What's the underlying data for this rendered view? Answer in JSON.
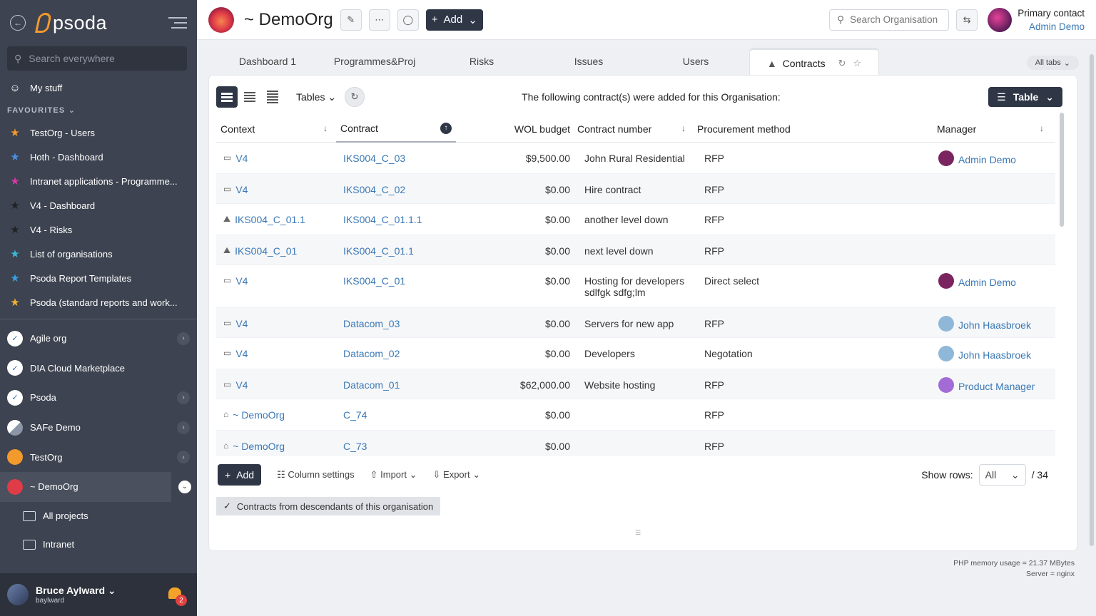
{
  "sidebar": {
    "logo": "psoda",
    "search_placeholder": "Search everywhere",
    "my_stuff": "My stuff",
    "favourites_label": "FAVOURITES",
    "favourites": [
      {
        "label": "TestOrg - Users",
        "color": "#f39a2c"
      },
      {
        "label": "Hoth - Dashboard",
        "color": "#4a8fe0"
      },
      {
        "label": "Intranet applications - Programme...",
        "color": "#d23aa5"
      },
      {
        "label": "V4 - Dashboard",
        "color": "#222222"
      },
      {
        "label": "V4 - Risks",
        "color": "#222222"
      },
      {
        "label": "List of organisations",
        "color": "#3ab8d8"
      },
      {
        "label": "Psoda Report Templates",
        "color": "#3a9fe0"
      },
      {
        "label": "Psoda (standard reports and work...",
        "color": "#f2b233"
      }
    ],
    "orgs": [
      {
        "label": "Agile org",
        "has_chevron": true
      },
      {
        "label": "DIA Cloud Marketplace",
        "has_chevron": false
      },
      {
        "label": "Psoda",
        "has_chevron": true
      },
      {
        "label": "SAFe Demo",
        "has_chevron": true
      },
      {
        "label": "TestOrg",
        "has_chevron": true
      },
      {
        "label": "~ DemoOrg",
        "has_chevron": true
      }
    ],
    "sub_items": [
      "All projects",
      "Intranet"
    ],
    "user": {
      "name": "Bruce Aylward",
      "login": "baylward",
      "notifications": "2"
    }
  },
  "header": {
    "org_title": "~ DemoOrg",
    "add_label": "Add",
    "search_placeholder": "Search Organisation",
    "contact_label": "Primary contact",
    "contact_name": "Admin Demo"
  },
  "tabs": {
    "items": [
      "Dashboard 1",
      "Programmes&Proj",
      "Risks",
      "Issues",
      "Users"
    ],
    "active": "Contracts",
    "all_tabs": "All tabs"
  },
  "toolbar": {
    "tables_label": "Tables",
    "caption": "The following contract(s) were added for this Organisation:",
    "view_label": "Table"
  },
  "table": {
    "headers": [
      "Context",
      "Contract",
      "WOL budget",
      "Contract number",
      "Procurement method",
      "Manager"
    ],
    "rows": [
      {
        "ctx_icon": "doc-icon",
        "context": "V4",
        "contract": "IKS004_C_03",
        "budget": "$9,500.00",
        "number": "John Rural Residential",
        "method": "RFP",
        "manager": "Admin Demo",
        "mgr_color": "#7a2560"
      },
      {
        "ctx_icon": "doc-icon",
        "context": "V4",
        "contract": "IKS004_C_02",
        "budget": "$0.00",
        "number": "Hire contract",
        "method": "RFP",
        "manager": "",
        "mgr_color": ""
      },
      {
        "ctx_icon": "mountain-icon",
        "context": "IKS004_C_01.1",
        "contract": "IKS004_C_01.1.1",
        "budget": "$0.00",
        "number": "another level down",
        "method": "RFP",
        "manager": "",
        "mgr_color": ""
      },
      {
        "ctx_icon": "mountain-icon",
        "context": "IKS004_C_01",
        "contract": "IKS004_C_01.1",
        "budget": "$0.00",
        "number": "next level down",
        "method": "RFP",
        "manager": "",
        "mgr_color": ""
      },
      {
        "ctx_icon": "doc-icon",
        "context": "V4",
        "contract": "IKS004_C_01",
        "budget": "$0.00",
        "number": "Hosting for developers sdlfgk sdfg;lm",
        "method": "Direct select",
        "manager": "Admin Demo",
        "mgr_color": "#7a2560"
      },
      {
        "ctx_icon": "doc-icon",
        "context": "V4",
        "contract": "Datacom_03",
        "budget": "$0.00",
        "number": "Servers for new app",
        "method": "RFP",
        "manager": "John Haasbroek",
        "mgr_color": "#8fb8d8"
      },
      {
        "ctx_icon": "doc-icon",
        "context": "V4",
        "contract": "Datacom_02",
        "budget": "$0.00",
        "number": "Developers",
        "method": "Negotation",
        "manager": "John Haasbroek",
        "mgr_color": "#8fb8d8"
      },
      {
        "ctx_icon": "doc-icon",
        "context": "V4",
        "contract": "Datacom_01",
        "budget": "$62,000.00",
        "number": "Website hosting",
        "method": "RFP",
        "manager": "Product Manager",
        "mgr_color": "#a36bd6"
      },
      {
        "ctx_icon": "building-icon",
        "context": "~ DemoOrg",
        "contract": "C_74",
        "budget": "$0.00",
        "number": "",
        "method": "RFP",
        "manager": "",
        "mgr_color": ""
      },
      {
        "ctx_icon": "building-icon",
        "context": "~ DemoOrg",
        "contract": "C_73",
        "budget": "$0.00",
        "number": "",
        "method": "RFP",
        "manager": "",
        "mgr_color": ""
      }
    ]
  },
  "bottom": {
    "add_label": "Add",
    "column_settings": "Column settings",
    "import_label": "Import",
    "export_label": "Export",
    "show_rows_label": "Show rows:",
    "show_rows_value": "All",
    "total": "/ 34",
    "descendants_filter": "Contracts from descendants of this organisation"
  },
  "footer": {
    "memory": "PHP memory usage = 21.37 MBytes",
    "server": "Server = nginx"
  }
}
